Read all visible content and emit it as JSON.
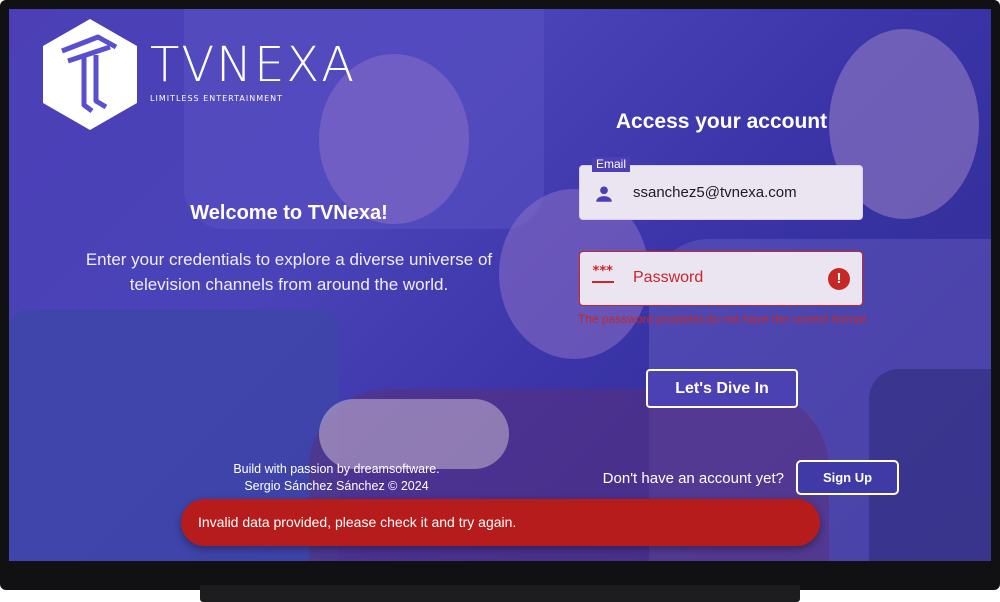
{
  "brand": {
    "name": "TVNEXA",
    "tagline": "LIMITLESS ENTERTAINMENT",
    "logo_icon": "tvnexa-hexagon-logo"
  },
  "welcome": {
    "title": "Welcome to TVNexa!",
    "text": "Enter your credentials to explore a diverse universe of television channels from around the world."
  },
  "footer": {
    "line1": "Build with passion by dreamsoftware.",
    "line2": "Sergio Sánchez Sánchez © 2024"
  },
  "form": {
    "title": "Access your account",
    "email": {
      "label": "Email",
      "value": "ssanchez5@tvnexa.com",
      "icon": "person-icon"
    },
    "password": {
      "placeholder": "Password",
      "icon": "password-icon",
      "error_icon": "error-icon",
      "error_text": "The password provided do not have the correct format"
    },
    "submit_label": "Let's Dive In",
    "signup_prompt": "Don't have an account yet?",
    "signup_label": "Sign Up"
  },
  "toast": {
    "message": "Invalid data provided, please check it and try again."
  },
  "colors": {
    "overlay": "#4c3fb6",
    "error": "#c62828",
    "toast_bg": "#b71c1c",
    "field_bg": "#ebe4f1"
  }
}
